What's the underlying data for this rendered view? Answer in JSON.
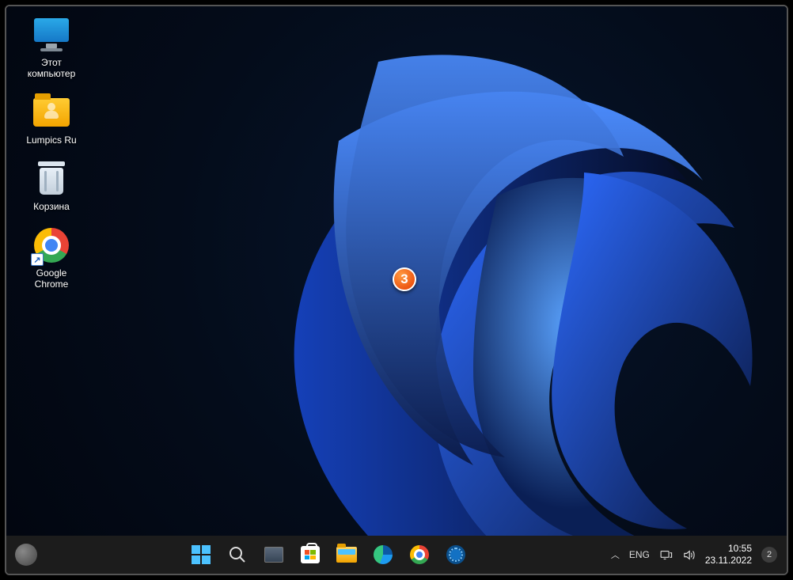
{
  "desktop": {
    "icons": [
      {
        "name": "this-pc",
        "label": "Этот\nкомпьютер",
        "type": "monitor"
      },
      {
        "name": "lumpics",
        "label": "Lumpics Ru",
        "type": "userfolder"
      },
      {
        "name": "recyclebin",
        "label": "Корзина",
        "type": "bin"
      },
      {
        "name": "chrome",
        "label": "Google\nChrome",
        "type": "chrome",
        "shortcut": true
      }
    ]
  },
  "annotation": {
    "number": "3"
  },
  "taskbar": {
    "pinned": [
      {
        "name": "start",
        "icon": "winlogo"
      },
      {
        "name": "search",
        "icon": "search"
      },
      {
        "name": "taskview",
        "icon": "taskview"
      },
      {
        "name": "ms-store",
        "icon": "store"
      },
      {
        "name": "explorer",
        "icon": "explorer"
      },
      {
        "name": "edge",
        "icon": "edge"
      },
      {
        "name": "chrome",
        "icon": "chrome-s"
      },
      {
        "name": "settings",
        "icon": "settings"
      }
    ],
    "tray": {
      "language": "ENG",
      "time": "10:55",
      "date": "23.11.2022",
      "notifications": "2"
    }
  }
}
